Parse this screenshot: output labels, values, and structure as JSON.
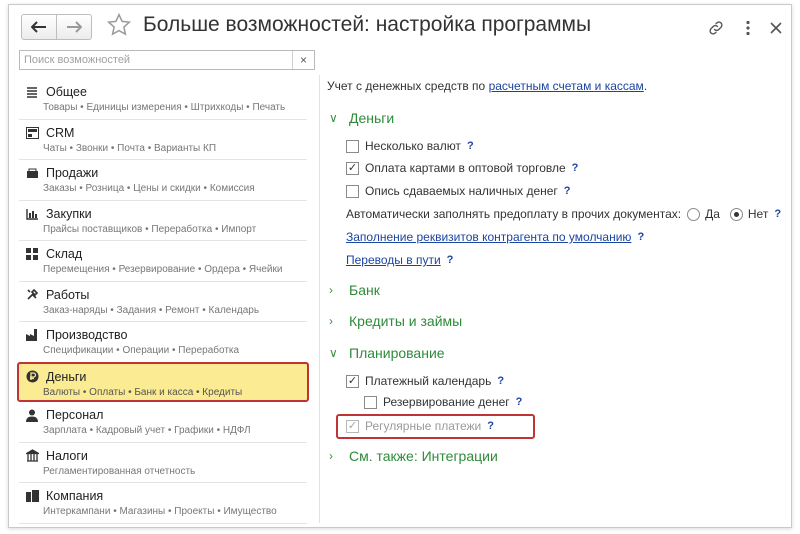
{
  "header": {
    "title": "Больше возможностей: настройка программы",
    "back_icon": "arrow-left-icon",
    "forward_icon": "arrow-right-icon",
    "favorite_icon": "star-icon",
    "link_icon": "link-icon",
    "more_icon": "more-icon",
    "close_icon": "close-icon"
  },
  "search": {
    "placeholder": "Поиск возможностей",
    "clear": "×"
  },
  "sidebar": {
    "items": [
      {
        "label": "Общее",
        "sub": "Товары • Единицы измерения • Штрихкоды • Печать",
        "icon": "list-icon"
      },
      {
        "label": "CRM",
        "sub": "Чаты • Звонки • Почта • Варианты КП",
        "icon": "crm-icon"
      },
      {
        "label": "Продажи",
        "sub": "Заказы • Розница • Цены и скидки • Комиссия",
        "icon": "sales-icon"
      },
      {
        "label": "Закупки",
        "sub": "Прайсы поставщиков • Переработка • Импорт",
        "icon": "purchases-icon"
      },
      {
        "label": "Склад",
        "sub": "Перемещения • Резервирование • Ордера • Ячейки",
        "icon": "warehouse-icon"
      },
      {
        "label": "Работы",
        "sub": "Заказ-наряды • Задания • Ремонт • Календарь",
        "icon": "tools-icon"
      },
      {
        "label": "Производство",
        "sub": "Спецификации • Операции • Переработка",
        "icon": "production-icon"
      },
      {
        "label": "Деньги",
        "sub": "Валюты • Оплаты • Банк и касса • Кредиты",
        "icon": "money-icon",
        "selected": true
      },
      {
        "label": "Персонал",
        "sub": "Зарплата • Кадровый учет • Графики • НДФЛ",
        "icon": "person-icon"
      },
      {
        "label": "Налоги",
        "sub": "Регламентированная отчетность",
        "icon": "taxes-icon"
      },
      {
        "label": "Компания",
        "sub": "Интеркампани • Магазины • Проекты • Имущество",
        "icon": "company-icon"
      }
    ],
    "selected_color": "#fbeb92",
    "highlight_color": "#c03434"
  },
  "main": {
    "note_prefix": "Учет с денежных средств по ",
    "note_link": "расчетным счетам и кассам",
    "note_suffix": ".",
    "groups": {
      "money": "Деньги",
      "bank": "Банк",
      "credits": "Кредиты и займы",
      "planning": "Планирование",
      "see_also": "См. также: Интеграции"
    },
    "options": {
      "multi_currency": {
        "label": "Несколько валют",
        "checked": false
      },
      "card_payment": {
        "label": "Оплата картами в оптовой торговле",
        "checked": true
      },
      "cash_inventory": {
        "label": "Опись сдаваемых наличных денег",
        "checked": false
      },
      "payment_calendar": {
        "label": "Платежный календарь",
        "checked": true
      },
      "money_reserve": {
        "label": "Резервирование денег",
        "checked": false
      },
      "regular_payments": {
        "label": "Регулярные платежи",
        "checked": true,
        "disabled": true
      }
    },
    "prepay": {
      "label": "Автоматически заполнять предоплату в прочих документах:",
      "yes": "Да",
      "no": "Нет",
      "selected": "Нет"
    },
    "links": {
      "counterparty": "Заполнение реквизитов контрагента по умолчанию",
      "transfers": "Переводы в пути"
    },
    "help": "?",
    "check_mark": "✓",
    "chevron_down": "∨",
    "chevron_right": "›",
    "accent_color": "#2e8b3a",
    "link_color": "#1b45a3"
  }
}
